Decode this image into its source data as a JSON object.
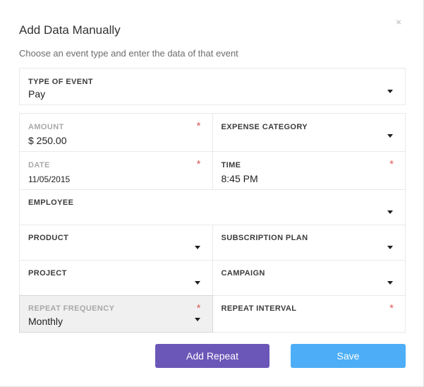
{
  "modal": {
    "title": "Add Data Manually",
    "subtitle": "Choose an event type and enter the data of that event",
    "close_glyph": "×"
  },
  "fields": {
    "type_of_event": {
      "label": "TYPE OF EVENT",
      "value": "Pay"
    },
    "amount": {
      "label": "AMOUNT",
      "value": "$ 250.00",
      "required_mark": "*"
    },
    "expense_category": {
      "label": "EXPENSE CATEGORY",
      "value": ""
    },
    "date": {
      "label": "DATE",
      "value": "11/05/2015",
      "required_mark": "*"
    },
    "time": {
      "label": "TIME",
      "value": "8:45 PM",
      "required_mark": "*"
    },
    "employee": {
      "label": "EMPLOYEE",
      "value": ""
    },
    "product": {
      "label": "PRODUCT",
      "value": ""
    },
    "subscription_plan": {
      "label": "SUBSCRIPTION PLAN",
      "value": ""
    },
    "project": {
      "label": "PROJECT",
      "value": ""
    },
    "campaign": {
      "label": "CAMPAIGN",
      "value": ""
    },
    "repeat_frequency": {
      "label": "REPEAT FREQUENCY",
      "value": "Monthly",
      "required_mark": "*"
    },
    "repeat_interval": {
      "label": "REPEAT INTERVAL",
      "value": "",
      "required_mark": "*"
    }
  },
  "buttons": {
    "add_repeat": "Add Repeat",
    "save": "Save"
  },
  "colors": {
    "add_repeat_bg": "#6b57b8",
    "save_bg": "#4daef7",
    "required": "#e05a5a"
  }
}
